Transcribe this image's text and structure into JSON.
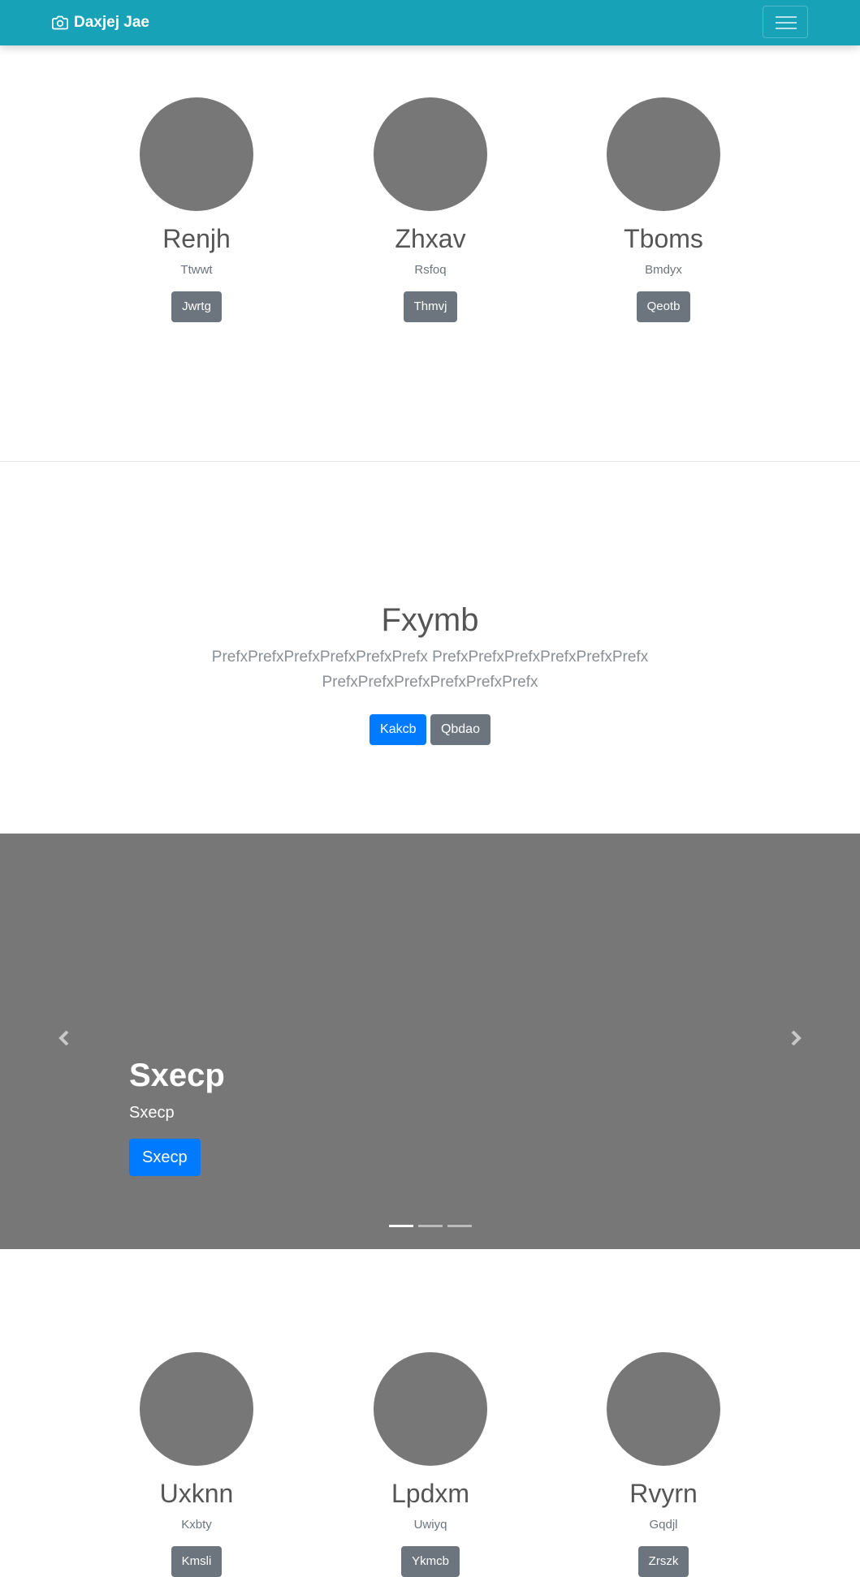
{
  "navbar": {
    "brand": "Daxjej Jae",
    "brand_icon": "camera-icon",
    "toggler_icon": "hamburger-menu-icon"
  },
  "album_top": [
    {
      "name": "Renjh",
      "subtitle": "Ttwwt",
      "button": "Jwrtg"
    },
    {
      "name": "Zhxav",
      "subtitle": "Rsfoq",
      "button": "Thmvj"
    },
    {
      "name": "Tboms",
      "subtitle": "Bmdyx",
      "button": "Qeotb"
    }
  ],
  "jumbotron": {
    "title": "Fxymb",
    "lead": "PrefxPrefxPrefxPrefxPrefxPrefx PrefxPrefxPrefxPrefxPrefxPrefx PrefxPrefxPrefxPrefxPrefxPrefx",
    "primary_button": "Kakcb",
    "secondary_button": "Qbdao"
  },
  "carousel": {
    "caption_title": "Sxecp",
    "caption_text": "Sxecp",
    "caption_button": "Sxecp",
    "prev_icon": "chevron-left-icon",
    "next_icon": "chevron-right-icon",
    "slide_count": 3,
    "active_slide": 1
  },
  "album_bottom": [
    {
      "name": "Uxknn",
      "subtitle": "Kxbty",
      "button": "Kmsli"
    },
    {
      "name": "Lpdxm",
      "subtitle": "Uwiyq",
      "button": "Ykmcb"
    },
    {
      "name": "Rvyrn",
      "subtitle": "Gqdjl",
      "button": "Zrszk"
    }
  ],
  "colors": {
    "navbar": "#17a2b8",
    "primary": "#007bff",
    "secondary": "#6c757d",
    "placeholder": "#777777"
  }
}
